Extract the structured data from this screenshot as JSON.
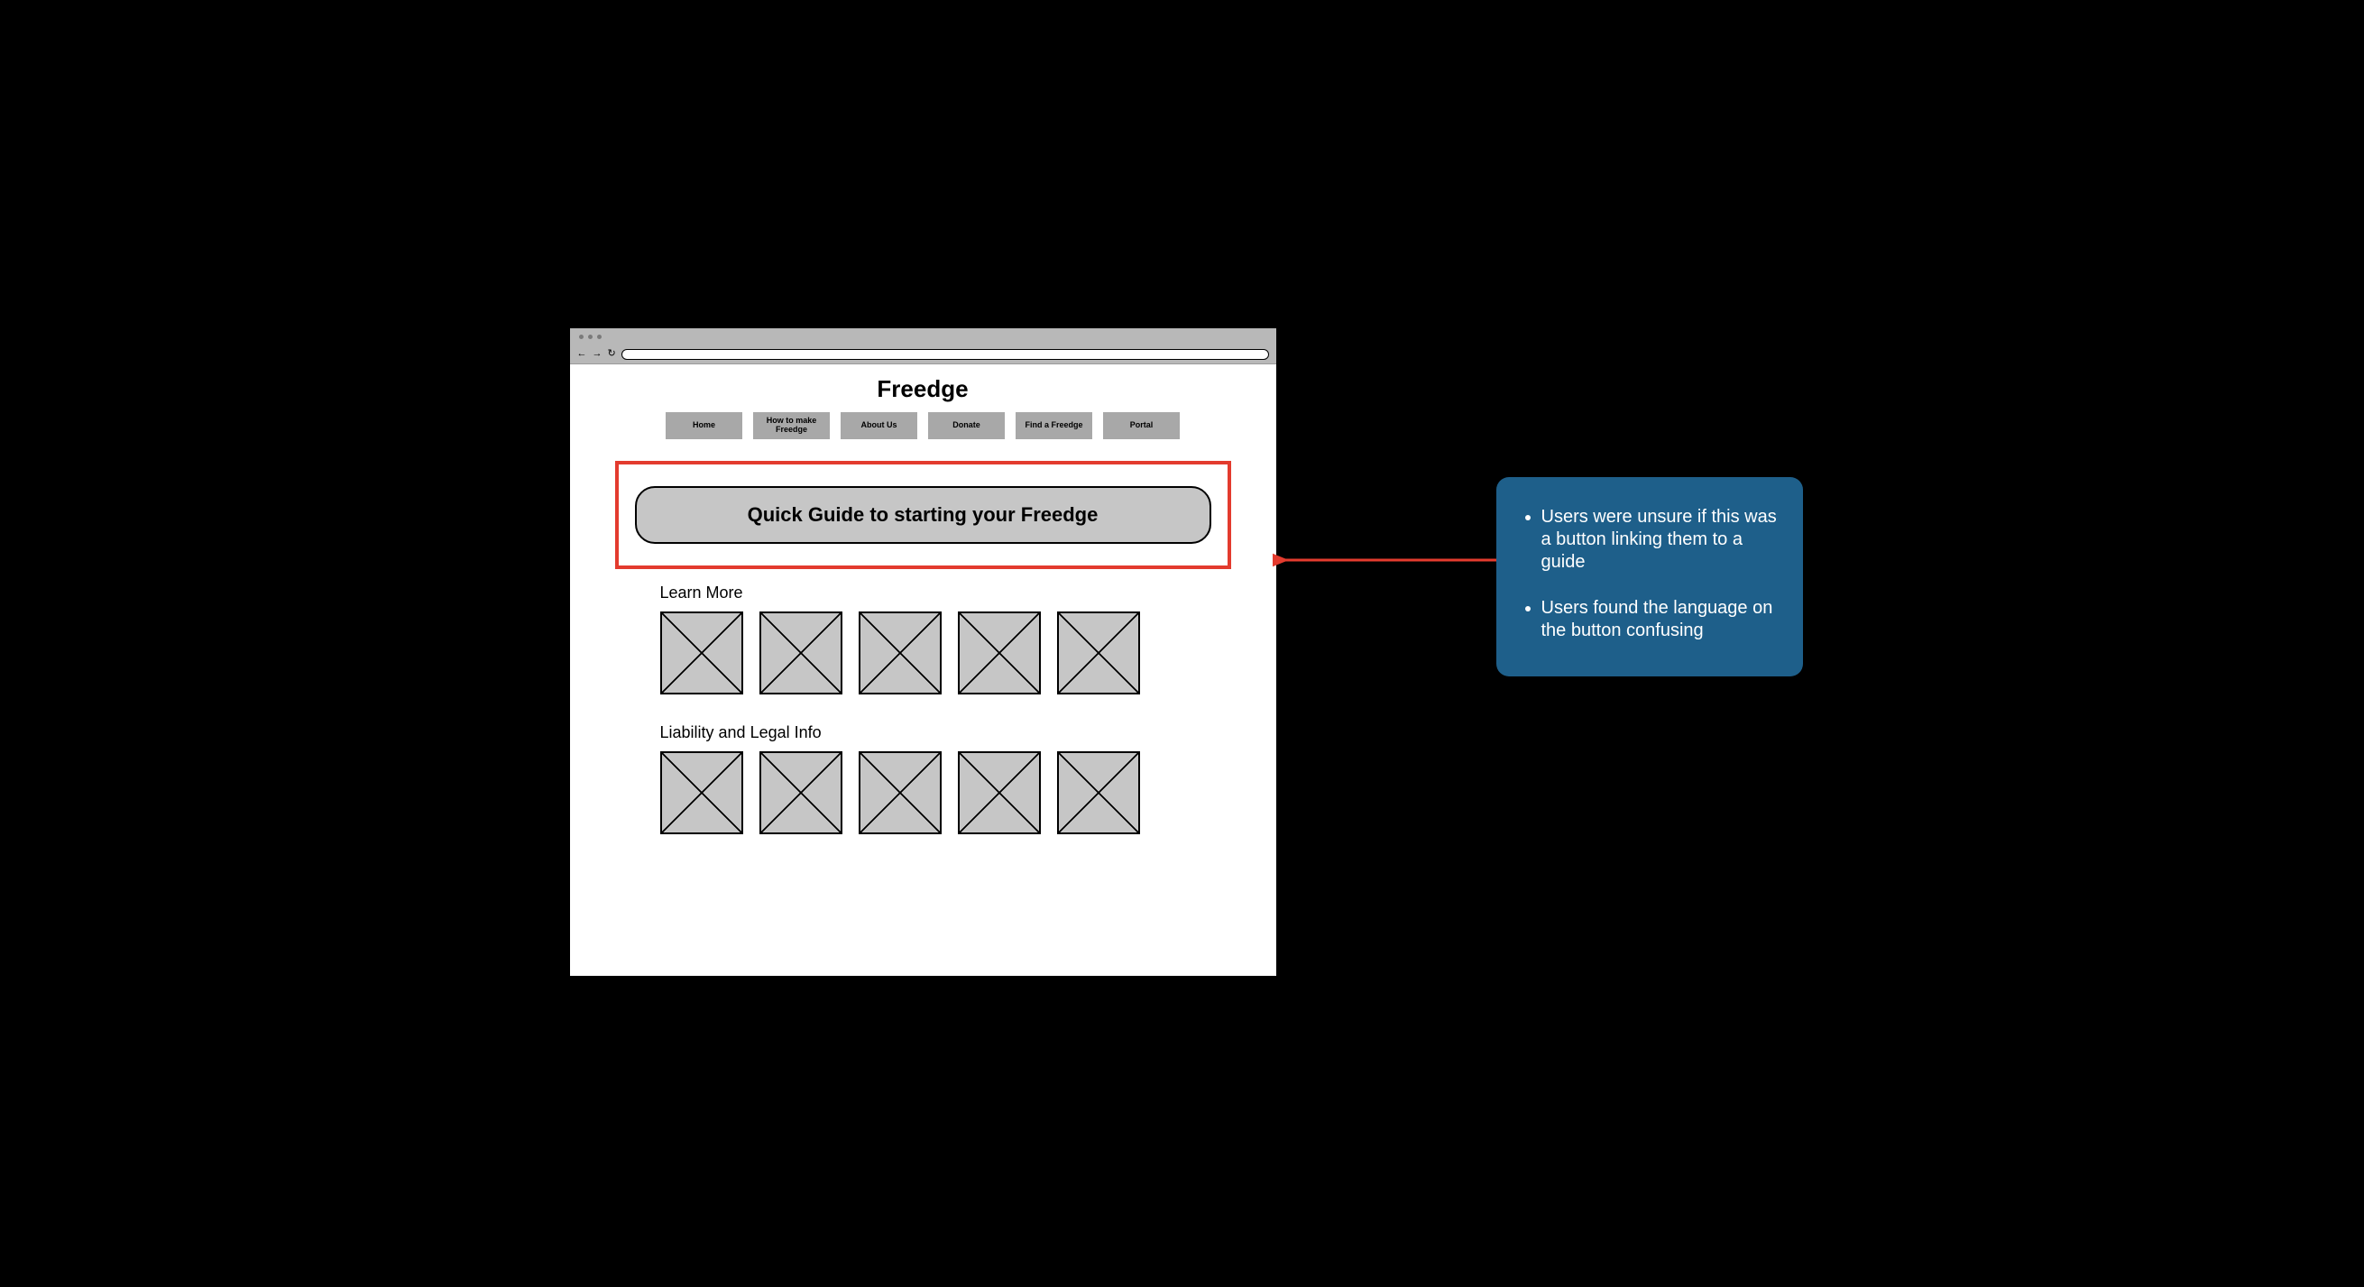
{
  "site": {
    "title": "Freedge",
    "nav": [
      {
        "label": "Home"
      },
      {
        "label": "How to make Freedge"
      },
      {
        "label": "About Us"
      },
      {
        "label": "Donate"
      },
      {
        "label": "Find a Freedge"
      },
      {
        "label": "Portal"
      }
    ],
    "quick_guide_label": "Quick Guide to starting your Freedge",
    "sections": {
      "learn_more": "Learn More",
      "legal": "Liability and Legal Info"
    }
  },
  "annotation": {
    "color": "#1e5f8a",
    "highlight_color": "#e33b2e",
    "bullets": [
      "Users were unsure if this was a button linking them to a guide",
      "Users found the language on the button confusing"
    ]
  }
}
